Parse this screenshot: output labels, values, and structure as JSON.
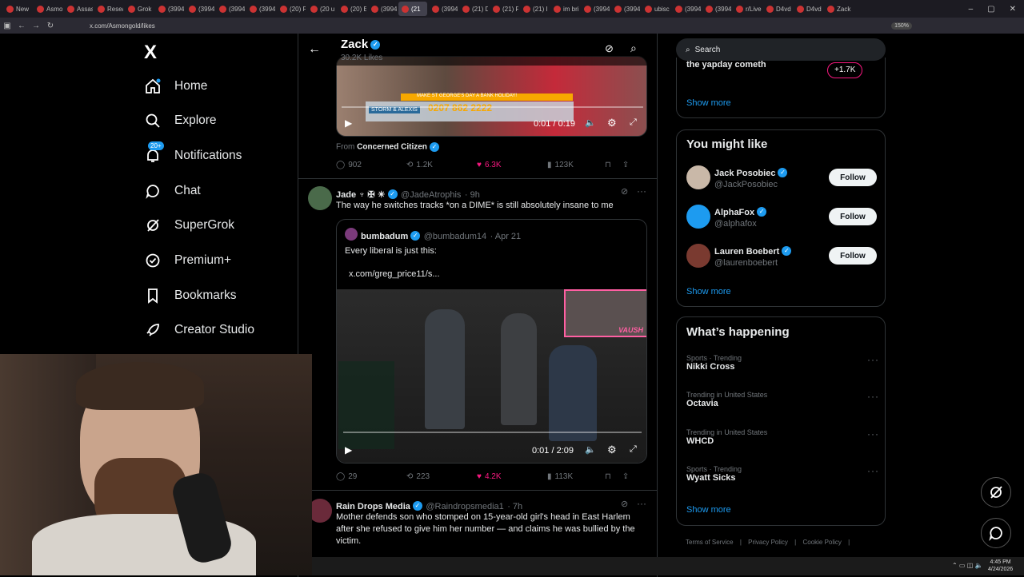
{
  "browser": {
    "tabs": [
      "New",
      "Asmo",
      "Assas",
      "Resea",
      "Grok",
      "(3994",
      "(3994",
      "(3994",
      "(3994",
      "(20) F",
      "(20 u",
      "(20) E",
      "(3994",
      "(21",
      "(3994",
      "(21) D",
      "(21) F",
      "(21) I",
      "im bri",
      "(3994",
      "(3994",
      "ubisc",
      "(3994",
      "(3994",
      "r/Live",
      "D4vd",
      "D4vd",
      "Zack"
    ],
    "active_tab_index": 13,
    "url": "x.com/Asmongold/likes",
    "zoom": "150%"
  },
  "nav": {
    "logo": "X",
    "items": [
      {
        "label": "Home",
        "icon": "home-icon"
      },
      {
        "label": "Explore",
        "icon": "search-icon"
      },
      {
        "label": "Notifications",
        "icon": "bell-icon",
        "badge": "20+"
      },
      {
        "label": "Chat",
        "icon": "chat-icon"
      },
      {
        "label": "SuperGrok",
        "icon": "grok-icon"
      },
      {
        "label": "Premium+",
        "icon": "verified-icon"
      },
      {
        "label": "Bookmarks",
        "icon": "bookmark-icon"
      },
      {
        "label": "Creator Studio",
        "icon": "rocket-icon"
      }
    ]
  },
  "header": {
    "name": "Zack",
    "likes": "30.2K Likes"
  },
  "tweet1": {
    "video_banner": "MAKE ST GEORGE'S DAY A BANK HOLIDAY!",
    "video_phone": "0207 862 2222",
    "video_names": "STORM & ALEXIS",
    "video_time": "0:01 / 0:19",
    "from_label": "From",
    "from_name": "Concerned Citizen",
    "replies": "902",
    "reposts": "1.2K",
    "likes": "6.3K",
    "views": "123K"
  },
  "tweet2": {
    "name": "Jade ♆ ✠ ☀",
    "handle": "@JadeAtrophis",
    "time": "· 9h",
    "text": "The way he switches tracks *on a DIME* is still absolutely insane to me",
    "quote": {
      "name": "bumbadum",
      "handle": "@bumbadum14",
      "date": "· Apr 21",
      "text": "Every liberal is just this:",
      "link": "x.com/greg_price11/s..."
    },
    "video_time": "0:01 / 2:09",
    "overlay_label": "VAUSH",
    "replies": "29",
    "reposts": "223",
    "likes": "4.2K",
    "views": "113K"
  },
  "tweet3": {
    "name": "Rain Drops Media",
    "handle": "@Raindropsmedia1",
    "time": "· 7h",
    "text": "Mother defends son who stomped on 15-year-old girl's head in East Harlem after she refused to give him her number — and claims he was bullied by the victim."
  },
  "search": {
    "placeholder": "Search"
  },
  "spaces": {
    "partial_text": "the yapday cometh",
    "listeners": "+1.7K",
    "show_more": "Show more"
  },
  "who_to_follow": {
    "title": "You might like",
    "users": [
      {
        "name": "Jack Posobiec",
        "handle": "@JackPosobiec",
        "button": "Follow"
      },
      {
        "name": "AlphaFox",
        "handle": "@alphafox",
        "button": "Follow"
      },
      {
        "name": "Lauren Boebert",
        "handle": "@laurenboebert",
        "button": "Follow"
      }
    ],
    "show_more": "Show more"
  },
  "trends": {
    "title": "What’s happening",
    "items": [
      {
        "meta": "Sports · Trending",
        "name": "Nikki Cross"
      },
      {
        "meta": "Trending in United States",
        "name": "Octavia"
      },
      {
        "meta": "Trending in United States",
        "name": "WHCD"
      },
      {
        "meta": "Sports · Trending",
        "name": "Wyatt Sicks"
      }
    ],
    "show_more": "Show more"
  },
  "footer": {
    "links": [
      "Terms of Service",
      "Privacy Policy",
      "Cookie Policy"
    ],
    "separator": "|"
  },
  "taskbar": {
    "time": "4:45 PM",
    "date": "4/24/2026"
  },
  "colors": {
    "accent": "#1d9bf0",
    "like": "#f91880",
    "bg": "#000000",
    "border": "#2f3336"
  }
}
